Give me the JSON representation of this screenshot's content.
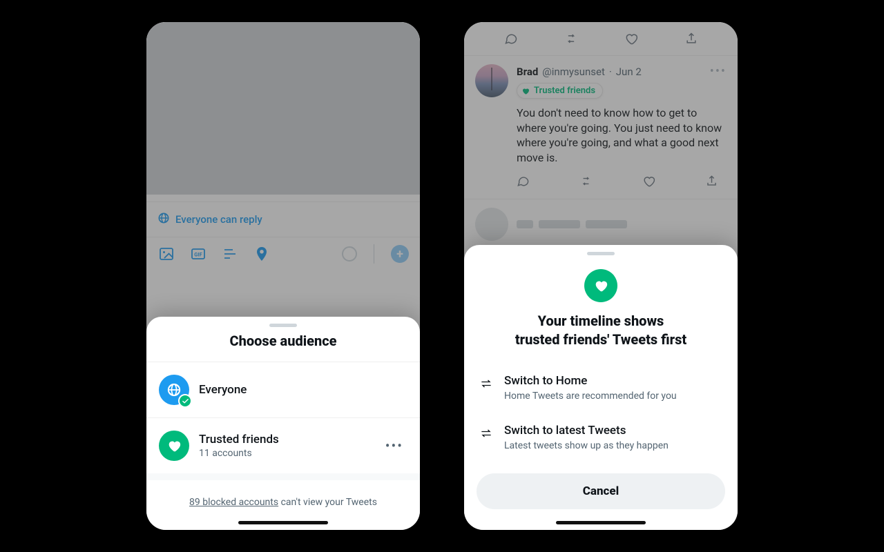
{
  "phone1": {
    "reply_setting": "Everyone can reply",
    "sheet": {
      "title": "Choose audience",
      "options": [
        {
          "label": "Everyone",
          "subtitle": "",
          "selected": true,
          "icon": "globe"
        },
        {
          "label": "Trusted friends",
          "subtitle": "11 accounts",
          "selected": false,
          "icon": "heart"
        }
      ],
      "footer_link": "89 blocked accounts",
      "footer_rest": " can't view your Tweets"
    }
  },
  "phone2": {
    "tweet": {
      "name": "Brad",
      "handle": "@inmysunset",
      "date": "Jun 2",
      "badge": "Trusted friends",
      "body": "You don't need to know how to get to where you're going. You just need to know where you're going, and what a good next move is."
    },
    "sheet": {
      "headline1": "Your timeline shows",
      "headline2": "trusted friends' Tweets first",
      "options": [
        {
          "title": "Switch to Home",
          "subtitle": "Home Tweets are recommended for you"
        },
        {
          "title": "Switch to latest Tweets",
          "subtitle": "Latest tweets show up as they happen"
        }
      ],
      "cancel": "Cancel"
    }
  }
}
